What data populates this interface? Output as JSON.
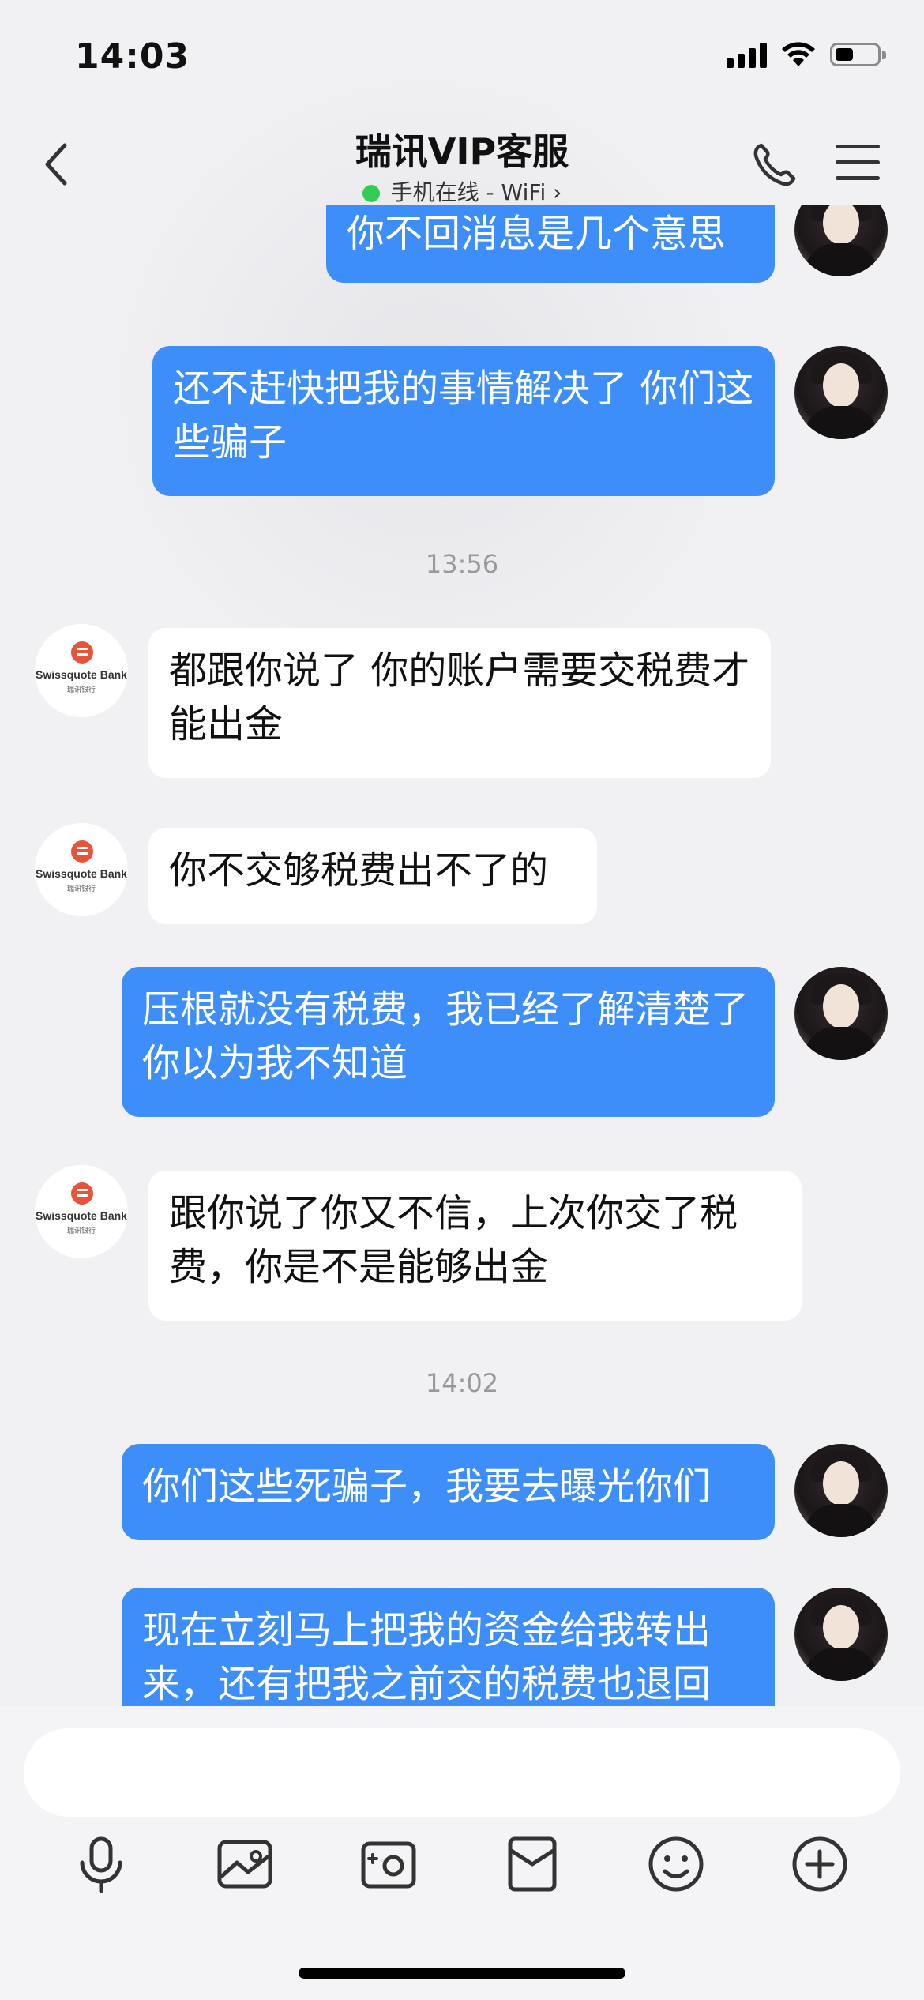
{
  "status_bar": {
    "time": "14:03"
  },
  "header": {
    "title": "瑞讯VIP客服",
    "subtitle": "手机在线 - WiFi ›",
    "online_color": "#33cc55"
  },
  "bank": {
    "name": "Swissquote Bank",
    "name_cn": "瑞讯银行"
  },
  "messages": [
    {
      "side": "out",
      "text": "你不回消息是几个意思"
    },
    {
      "side": "out",
      "text": "还不赶快把我的事情解决了 你们这些骗子"
    },
    {
      "timestamp": "13:56"
    },
    {
      "side": "in",
      "text": "都跟你说了 你的账户需要交税费才能出金"
    },
    {
      "side": "in",
      "text": "你不交够税费出不了的"
    },
    {
      "side": "out",
      "text": "压根就没有税费，我已经了解清楚了你以为我不知道"
    },
    {
      "side": "in",
      "text": "跟你说了你又不信，上次你交了税费，你是不是能够出金"
    },
    {
      "timestamp": "14:02"
    },
    {
      "side": "out",
      "text": "你们这些死骗子，我要去曝光你们"
    },
    {
      "side": "out",
      "text": "现在立刻马上把我的资金给我转出来，还有把我之前交的税费也退回"
    }
  ],
  "input": {
    "placeholder": ""
  },
  "toolbar_icons": [
    "microphone-icon",
    "image-icon",
    "camera-icon",
    "red-packet-icon",
    "emoji-icon",
    "plus-icon"
  ],
  "colors": {
    "outgoing_bubble": "#3d8ef8",
    "incoming_bubble": "#ffffff",
    "background": "#f1f1f3"
  }
}
